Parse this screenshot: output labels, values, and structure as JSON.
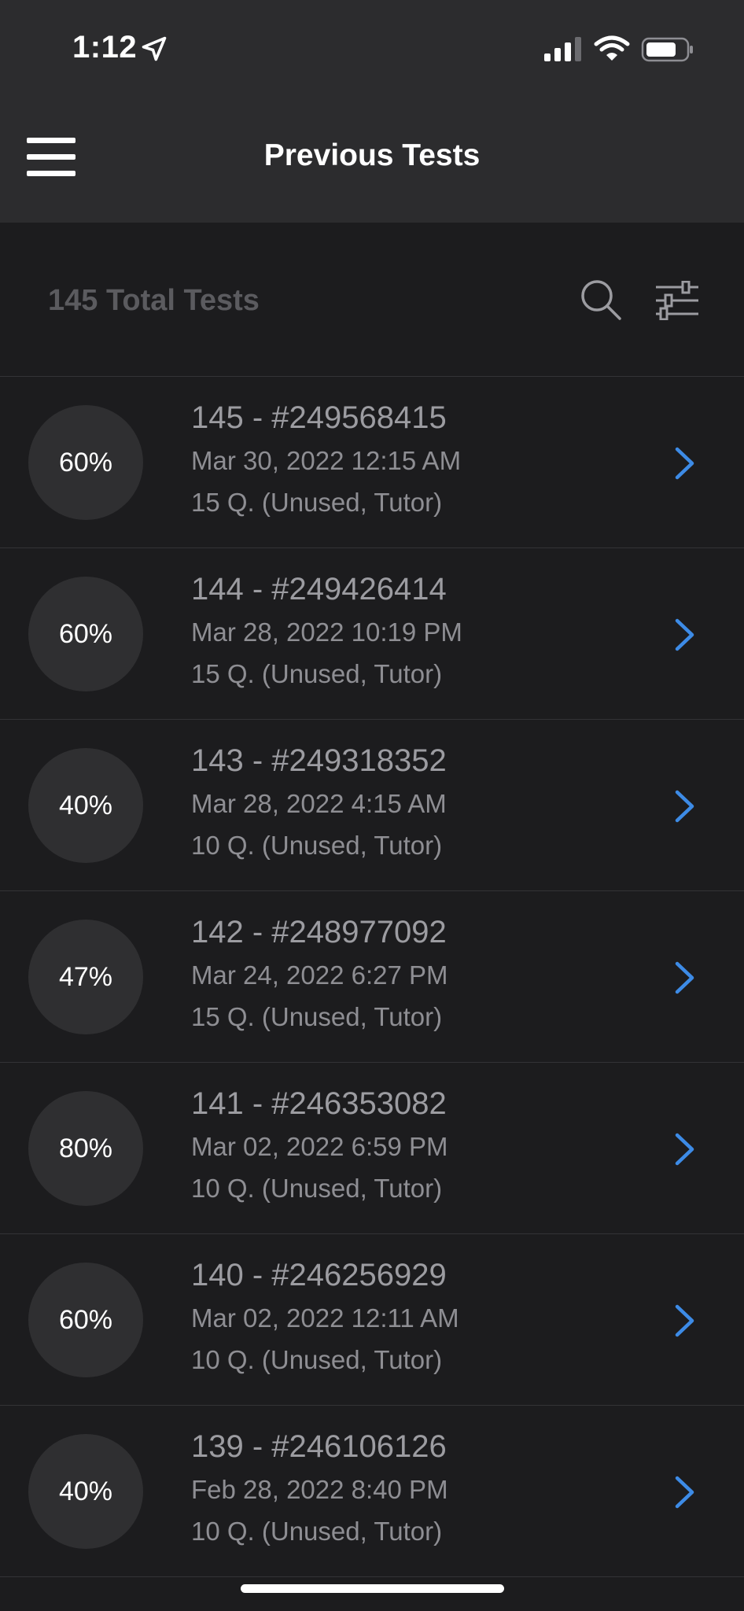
{
  "status_bar": {
    "time": "1:12"
  },
  "nav": {
    "title": "Previous Tests"
  },
  "toolbar": {
    "total_label": "145 Total Tests"
  },
  "tests": [
    {
      "score": "60%",
      "title": "145 - #249568415",
      "date": "Mar 30, 2022 12:15 AM",
      "meta": "15 Q. (Unused, Tutor)"
    },
    {
      "score": "60%",
      "title": "144 - #249426414",
      "date": "Mar 28, 2022 10:19 PM",
      "meta": "15 Q. (Unused, Tutor)"
    },
    {
      "score": "40%",
      "title": "143 - #249318352",
      "date": "Mar 28, 2022 4:15 AM",
      "meta": "10 Q. (Unused, Tutor)"
    },
    {
      "score": "47%",
      "title": "142 - #248977092",
      "date": "Mar 24, 2022 6:27 PM",
      "meta": "15 Q. (Unused, Tutor)"
    },
    {
      "score": "80%",
      "title": "141 - #246353082",
      "date": "Mar 02, 2022 6:59 PM",
      "meta": "10 Q. (Unused, Tutor)"
    },
    {
      "score": "60%",
      "title": "140 - #246256929",
      "date": "Mar 02, 2022 12:11 AM",
      "meta": "10 Q. (Unused, Tutor)"
    },
    {
      "score": "40%",
      "title": "139 - #246106126",
      "date": "Feb 28, 2022 8:40 PM",
      "meta": "10 Q. (Unused, Tutor)"
    }
  ],
  "colors": {
    "accent": "#3d8be6",
    "background": "#1c1c1e",
    "bar": "#2c2c2e",
    "score_circle": "#2f2f31"
  },
  "icons": [
    "location-arrow-icon",
    "signal-icon",
    "wifi-icon",
    "battery-icon",
    "menu-icon",
    "search-icon",
    "filter-sliders-icon",
    "chevron-right-icon"
  ]
}
